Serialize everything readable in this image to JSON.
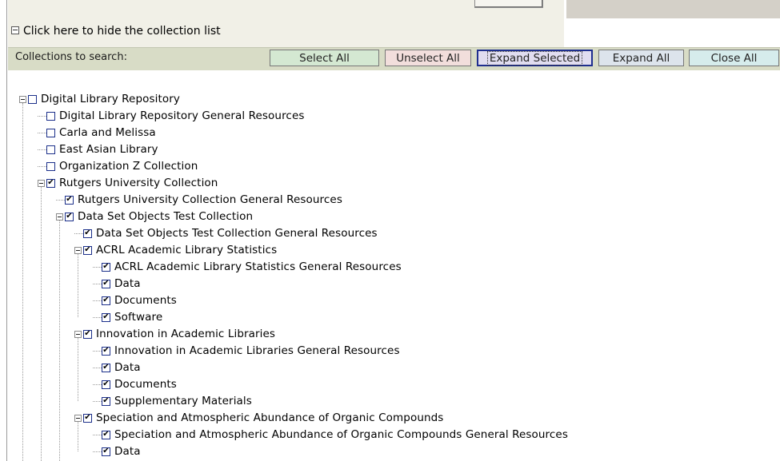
{
  "toggle": {
    "label": "Click here to hide the collection list"
  },
  "toolbar": {
    "label": "Collections to search:",
    "select_all": "Select All",
    "unselect_all": "Unselect All",
    "expand_selected": "Expand Selected",
    "expand_all": "Expand All",
    "close_all": "Close All"
  },
  "tree": [
    {
      "label": "Digital Library Repository",
      "checked": false,
      "expander": true,
      "depth": 0
    },
    {
      "label": "Digital Library Repository General Resources",
      "checked": false,
      "expander": false,
      "depth": 1
    },
    {
      "label": "Carla and Melissa",
      "checked": false,
      "expander": false,
      "depth": 1
    },
    {
      "label": "East Asian Library",
      "checked": false,
      "expander": false,
      "depth": 1
    },
    {
      "label": "Organization Z Collection",
      "checked": false,
      "expander": false,
      "depth": 1
    },
    {
      "label": "Rutgers University Collection",
      "checked": true,
      "expander": true,
      "depth": 1
    },
    {
      "label": "Rutgers University Collection General Resources",
      "checked": true,
      "expander": false,
      "depth": 2
    },
    {
      "label": "Data Set Objects Test Collection",
      "checked": true,
      "expander": true,
      "depth": 2
    },
    {
      "label": "Data Set Objects Test Collection General Resources",
      "checked": true,
      "expander": false,
      "depth": 3
    },
    {
      "label": "ACRL Academic Library Statistics",
      "checked": true,
      "expander": true,
      "depth": 3
    },
    {
      "label": "ACRL Academic Library Statistics General Resources",
      "checked": true,
      "expander": false,
      "depth": 4
    },
    {
      "label": "Data",
      "checked": true,
      "expander": false,
      "depth": 4
    },
    {
      "label": "Documents",
      "checked": true,
      "expander": false,
      "depth": 4
    },
    {
      "label": "Software",
      "checked": true,
      "expander": false,
      "depth": 4
    },
    {
      "label": "Innovation in Academic Libraries",
      "checked": true,
      "expander": true,
      "depth": 3
    },
    {
      "label": "Innovation in Academic Libraries General Resources",
      "checked": true,
      "expander": false,
      "depth": 4
    },
    {
      "label": "Data",
      "checked": true,
      "expander": false,
      "depth": 4
    },
    {
      "label": "Documents",
      "checked": true,
      "expander": false,
      "depth": 4
    },
    {
      "label": "Supplementary Materials",
      "checked": true,
      "expander": false,
      "depth": 4
    },
    {
      "label": "Speciation and Atmospheric Abundance of Organic Compounds",
      "checked": true,
      "expander": true,
      "depth": 3
    },
    {
      "label": "Speciation and Atmospheric Abundance of Organic Compounds General Resources",
      "checked": true,
      "expander": false,
      "depth": 4
    },
    {
      "label": "Data",
      "checked": true,
      "expander": false,
      "depth": 4
    }
  ]
}
